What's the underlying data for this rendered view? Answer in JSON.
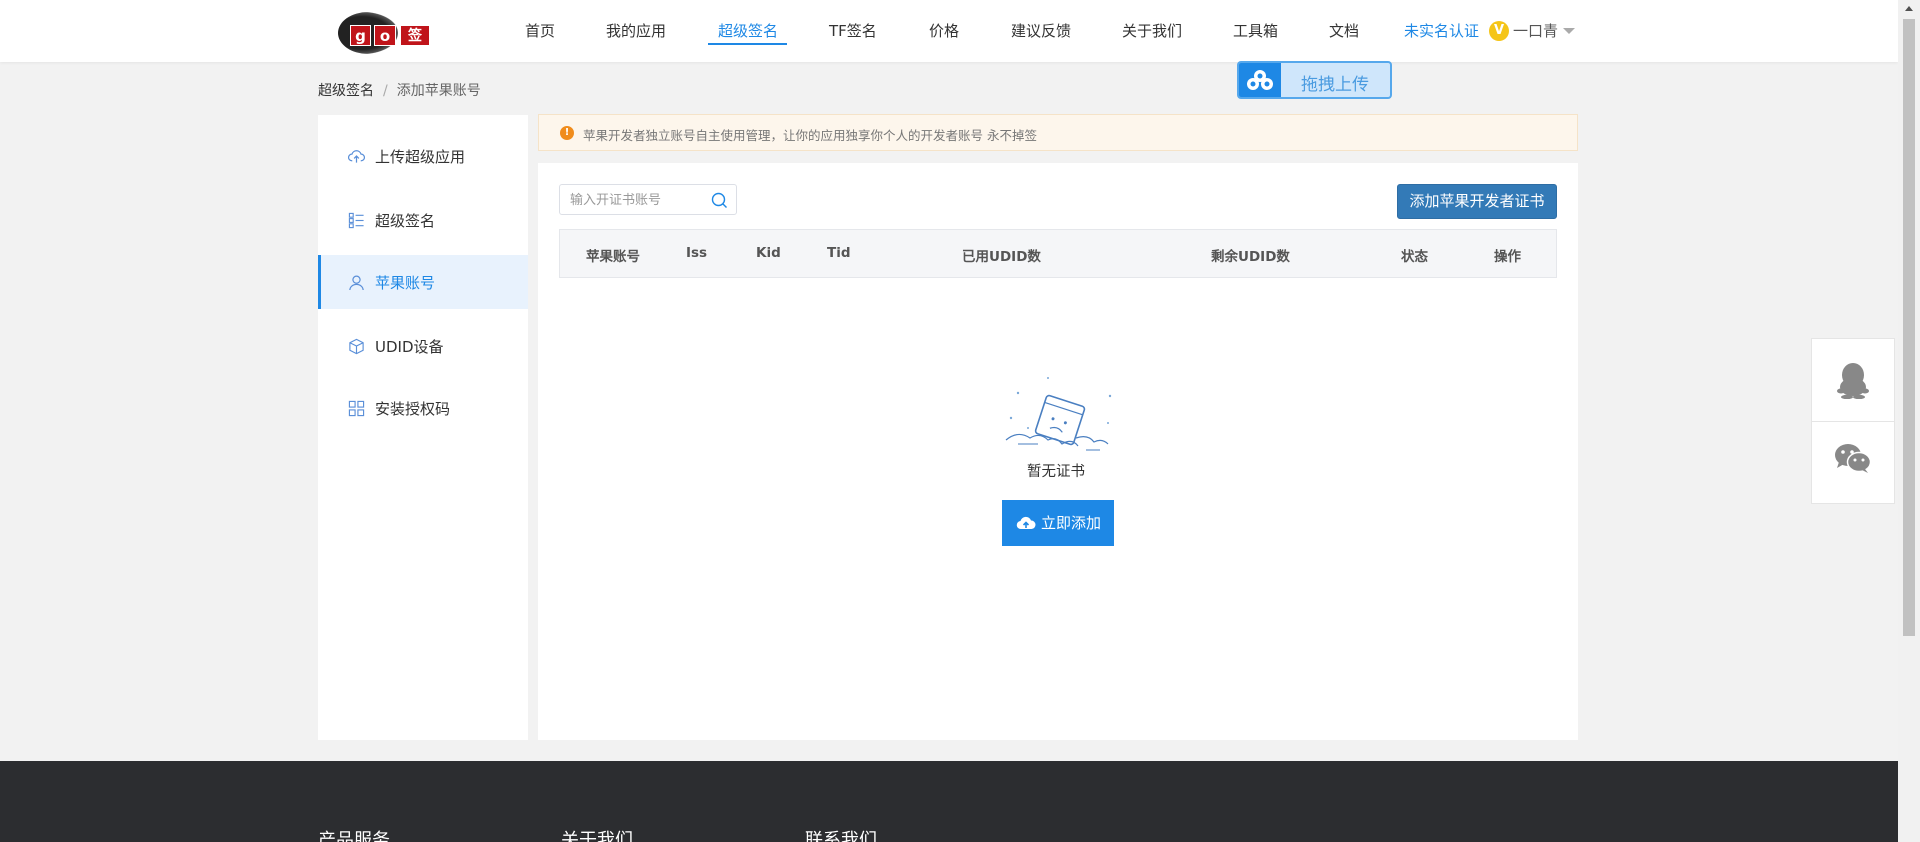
{
  "logo": {
    "tiles": [
      "g",
      "o",
      "签"
    ]
  },
  "nav": {
    "items": [
      "首页",
      "我的应用",
      "超级签名",
      "TF签名",
      "价格",
      "建议反馈",
      "关于我们",
      "工具箱",
      "文档"
    ],
    "active_index": 2,
    "verify_link": "未实名认证",
    "vip_badge": "V",
    "username": "一口青"
  },
  "drag_upload": {
    "label": "拖拽上传"
  },
  "breadcrumb": {
    "parent": "超级签名",
    "separator": "/",
    "current": "添加苹果账号"
  },
  "sidebar": {
    "items": [
      {
        "label": "上传超级应用",
        "icon": "cloud-upload-icon"
      },
      {
        "label": "超级签名",
        "icon": "list-icon"
      },
      {
        "label": "苹果账号",
        "icon": "user-icon"
      },
      {
        "label": "UDID设备",
        "icon": "cube-icon"
      },
      {
        "label": "安装授权码",
        "icon": "grid-icon"
      }
    ],
    "active_index": 2
  },
  "notice": {
    "text": "苹果开发者独立账号自主使用管理，让你的应用独享你个人的开发者账号 永不掉签"
  },
  "search": {
    "placeholder": "输入开证书账号"
  },
  "add_cert_button": "添加苹果开发者证书",
  "table": {
    "columns": [
      "苹果账号",
      "Iss",
      "Kid",
      "Tid",
      "已用UDID数",
      "剩余UDID数",
      "状态",
      "操作"
    ],
    "rows": []
  },
  "empty": {
    "text": "暂无证书",
    "button": "立即添加"
  },
  "footer": {
    "columns": [
      "产品服务",
      "关于我们",
      "联系我们"
    ]
  },
  "colors": {
    "accent": "#1e88e5",
    "button_dark": "#337ab7",
    "footer_bg": "#2c2d30",
    "notice_bg": "#fdf6ec",
    "warning": "#f08c1c"
  }
}
